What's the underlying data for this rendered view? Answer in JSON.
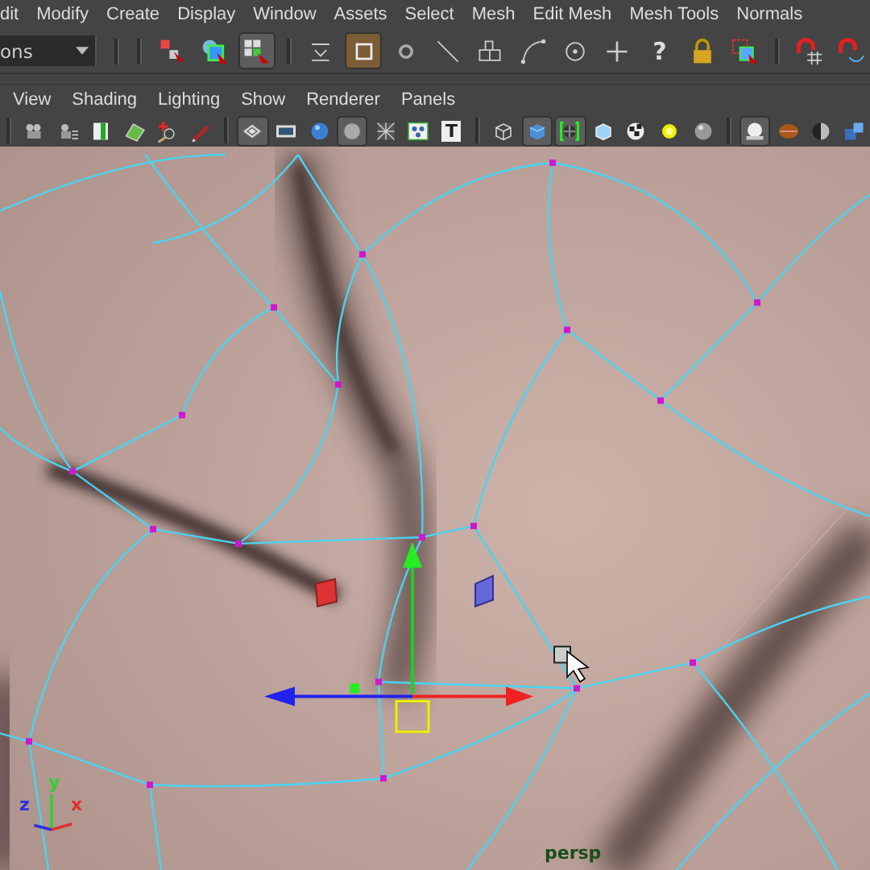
{
  "menu_bar": {
    "items": [
      "dit",
      "Modify",
      "Create",
      "Display",
      "Window",
      "Assets",
      "Select",
      "Mesh",
      "Edit Mesh",
      "Mesh Tools",
      "Normals"
    ]
  },
  "status_line": {
    "mode_dropdown": {
      "value": "ons"
    },
    "tools": [
      {
        "kind": "separator"
      },
      {
        "kind": "separator"
      },
      {
        "kind": "select-hierarchy",
        "selected": false
      },
      {
        "kind": "select-object",
        "selected": false
      },
      {
        "kind": "select-component",
        "selected": true
      },
      {
        "kind": "separator"
      },
      {
        "kind": "stack",
        "selected": false
      },
      {
        "kind": "square",
        "selected": true
      },
      {
        "kind": "circle",
        "selected": false
      },
      {
        "kind": "line",
        "selected": false
      },
      {
        "kind": "vertex",
        "selected": false
      },
      {
        "kind": "curve",
        "selected": false
      },
      {
        "kind": "target",
        "selected": false
      },
      {
        "kind": "plus",
        "selected": false
      },
      {
        "kind": "glyph",
        "text": "?",
        "selected": false
      },
      {
        "kind": "lock",
        "selected": false
      },
      {
        "kind": "marquee",
        "selected": false
      },
      {
        "kind": "separator"
      },
      {
        "kind": "magnet-grid",
        "selected": false
      },
      {
        "kind": "magnet-curve",
        "selected": false
      }
    ]
  },
  "panel_menu": {
    "items": [
      "View",
      "Shading",
      "Lighting",
      "Show",
      "Renderer",
      "Panels"
    ]
  },
  "panel_toolbar": {
    "tools": [
      {
        "kind": "separator"
      },
      {
        "kind": "camera",
        "selected": false
      },
      {
        "kind": "camera-list",
        "selected": false
      },
      {
        "kind": "bookmark",
        "selected": false
      },
      {
        "kind": "image",
        "selected": false
      },
      {
        "kind": "crosshair",
        "selected": false
      },
      {
        "kind": "pencil",
        "selected": false
      },
      {
        "kind": "separator"
      },
      {
        "kind": "grid",
        "selected": true
      },
      {
        "kind": "film",
        "selected": false
      },
      {
        "kind": "sphere-shaded",
        "selected": false
      },
      {
        "kind": "disc",
        "selected": true
      },
      {
        "kind": "xray",
        "selected": false
      },
      {
        "kind": "dots",
        "selected": false
      },
      {
        "kind": "glyph",
        "text": "T",
        "selected": false
      },
      {
        "kind": "separator"
      },
      {
        "kind": "cube-wire",
        "selected": false
      },
      {
        "kind": "cube-shaded",
        "selected": true
      },
      {
        "kind": "checker-bracket",
        "selected": true
      },
      {
        "kind": "cube-light",
        "selected": false
      },
      {
        "kind": "checker",
        "selected": false
      },
      {
        "kind": "light",
        "selected": false
      },
      {
        "kind": "sphere",
        "selected": false
      },
      {
        "kind": "separator"
      },
      {
        "kind": "lit-sphere",
        "selected": true
      },
      {
        "kind": "ball",
        "selected": false
      },
      {
        "kind": "half-sphere",
        "selected": false
      },
      {
        "kind": "cubes",
        "selected": false
      }
    ]
  },
  "viewport": {
    "axis_labels": [
      "z",
      "y",
      "x"
    ],
    "camera_label": "persp"
  }
}
